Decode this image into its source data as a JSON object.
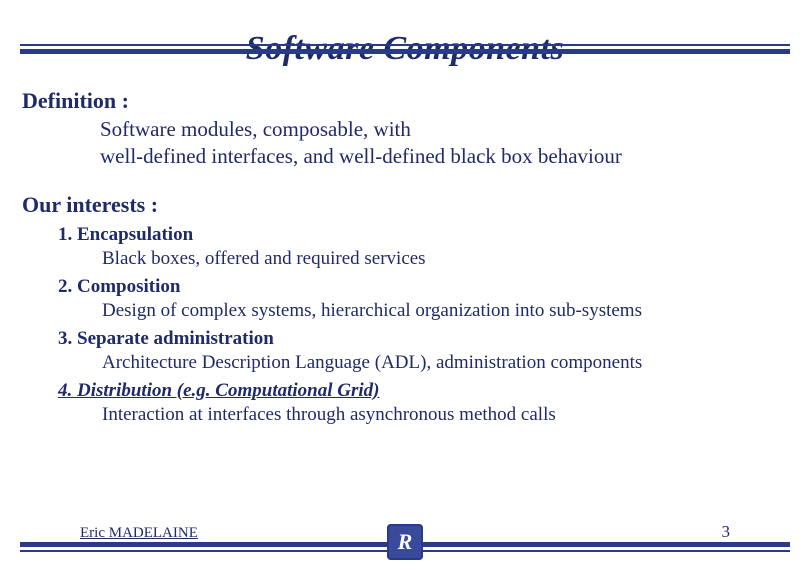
{
  "title": "Software Components",
  "definition": {
    "heading": "Definition :",
    "body_line1": "Software modules, composable, with",
    "body_line2": "well-defined interfaces, and well-defined black box behaviour"
  },
  "interests": {
    "heading": "Our interests :",
    "items": [
      {
        "label": "1. Encapsulation",
        "detail": "Black boxes, offered and required services",
        "emph": false
      },
      {
        "label": "2. Composition",
        "detail": "Design of complex systems, hierarchical organization into sub-systems",
        "emph": false
      },
      {
        "label": "3. Separate administration",
        "detail": "Architecture Description Language (ADL), administration components",
        "emph": false
      },
      {
        "label": "4. Distribution (e.g. Computational Grid)",
        "detail": "Interaction at interfaces through asynchronous method calls",
        "emph": true
      }
    ]
  },
  "footer": {
    "author": "Eric MADELAINE",
    "page": "3",
    "logo_glyph": "R"
  }
}
